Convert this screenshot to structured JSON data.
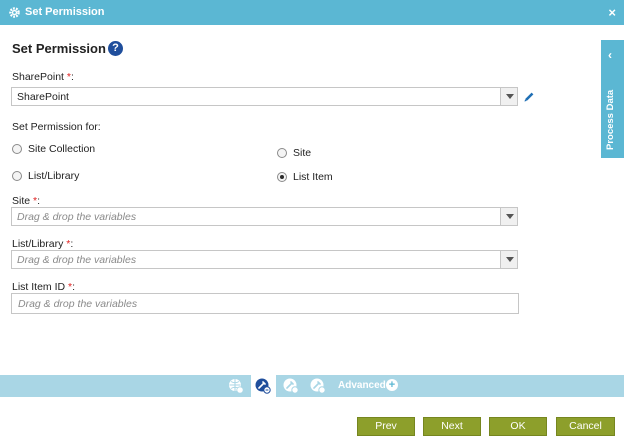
{
  "window": {
    "title": "Set Permission",
    "close_label": "×"
  },
  "heading": {
    "title": "Set Permission",
    "help_label": "?"
  },
  "sharepoint": {
    "label": "SharePoint",
    "required": "*",
    "colon": ":",
    "value": "SharePoint"
  },
  "set_permission_for": {
    "label": "Set Permission for:",
    "options": [
      {
        "label": "Site Collection",
        "selected": false
      },
      {
        "label": "Site",
        "selected": false
      },
      {
        "label": "List/Library",
        "selected": false
      },
      {
        "label": "List Item",
        "selected": true
      }
    ]
  },
  "site": {
    "label": "Site",
    "required": "*",
    "colon": ":",
    "placeholder": "Drag & drop the variables"
  },
  "list_library": {
    "label": "List/Library",
    "required": "*",
    "colon": ":",
    "placeholder": "Drag & drop the variables"
  },
  "list_item_id": {
    "label": "List Item ID",
    "required": "*",
    "colon": ":",
    "placeholder": "Drag & drop the variables"
  },
  "side_panel": {
    "label": "Process Data",
    "chevron": "‹"
  },
  "toolbar": {
    "advanced_label": "Advanced",
    "advanced_plus": "+"
  },
  "buttons": {
    "prev": "Prev",
    "next": "Next",
    "ok": "OK",
    "cancel": "Cancel"
  },
  "colors": {
    "accent": "#5bb7d3",
    "toolbar": "#a9d6e5",
    "button": "#8d9f2b",
    "required": "#e02020",
    "help": "#1f4e9c"
  }
}
